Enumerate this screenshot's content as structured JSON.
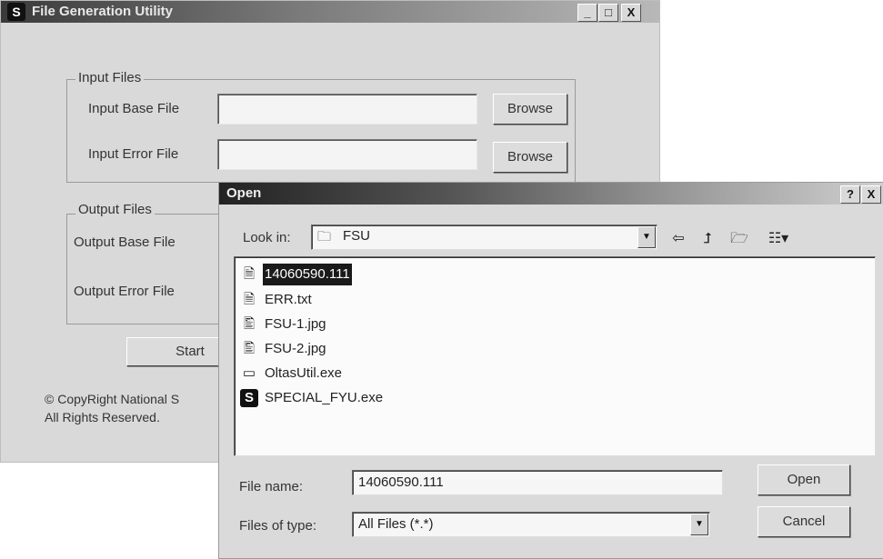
{
  "main_window": {
    "title": "File Generation Utility",
    "controls": [
      "_",
      "□",
      "X"
    ],
    "input_group": {
      "label": "Input Files",
      "base_label": "Input Base File",
      "error_label": "Input Error File",
      "browse1": "Browse",
      "browse2": "Browse"
    },
    "output_group": {
      "label": "Output Files",
      "base_label": "Output Base File",
      "error_label": "Output Error File"
    },
    "start_button": "Start",
    "copyright_line1": "© CopyRight National S",
    "copyright_line2": "All Rights Reserved."
  },
  "open_dialog": {
    "title": "Open",
    "help_button": "?",
    "close_button": "X",
    "look_in_label": "Look in:",
    "look_in_value": "FSU",
    "files": [
      {
        "name": "14060590.111",
        "icon": "text-file-icon",
        "selected": true
      },
      {
        "name": "ERR.txt",
        "icon": "text-file-icon",
        "selected": false
      },
      {
        "name": "FSU-1.jpg",
        "icon": "image-file-icon",
        "selected": false
      },
      {
        "name": "FSU-2.jpg",
        "icon": "image-file-icon",
        "selected": false
      },
      {
        "name": "OltasUtil.exe",
        "icon": "exe-file-icon",
        "selected": false
      },
      {
        "name": "SPECIAL_FYU.exe",
        "icon": "app-exe-icon",
        "selected": false
      }
    ],
    "file_name_label": "File name:",
    "file_name_value": "14060590.111",
    "files_of_type_label": "Files of type:",
    "files_of_type_value": "All Files (*.*)",
    "open_button": "Open",
    "cancel_button": "Cancel"
  }
}
